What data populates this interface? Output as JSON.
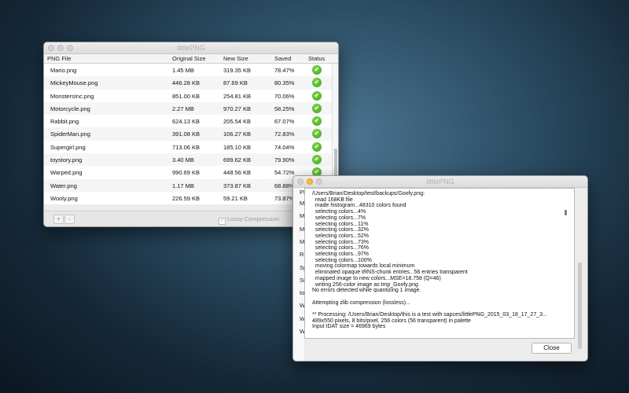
{
  "main_window": {
    "title": "littlePNG",
    "columns": [
      "PNG File",
      "Original Size",
      "New Size",
      "Saved",
      "Status"
    ],
    "rows": [
      {
        "file": "Mario.png",
        "original": "1.45 MB",
        "new": "319.35 KB",
        "saved": "78.47%"
      },
      {
        "file": "MickeyMouse.png",
        "original": "446.28 KB",
        "new": "87.69 KB",
        "saved": "80.35%"
      },
      {
        "file": "MonstersInc.png",
        "original": "851.00 KB",
        "new": "254.81 KB",
        "saved": "70.06%"
      },
      {
        "file": "Motorcycle.png",
        "original": "2.27 MB",
        "new": "970.27 KB",
        "saved": "58.25%"
      },
      {
        "file": "Rabbit.png",
        "original": "624.13 KB",
        "new": "205.54 KB",
        "saved": "67.07%"
      },
      {
        "file": "SpiderMan.png",
        "original": "391.08 KB",
        "new": "106.27 KB",
        "saved": "72.83%"
      },
      {
        "file": "Supergirl.png",
        "original": "713.06 KB",
        "new": "185.10 KB",
        "saved": "74.04%"
      },
      {
        "file": "toystory.png",
        "original": "3.40 MB",
        "new": "699.62 KB",
        "saved": "79.90%"
      },
      {
        "file": "Warped.png",
        "original": "990.69 KB",
        "new": "448.56 KB",
        "saved": "54.72%"
      },
      {
        "file": "Water.png",
        "original": "1.17 MB",
        "new": "373.87 KB",
        "saved": "68.88%"
      },
      {
        "file": "Wooly.png",
        "original": "226.59 KB",
        "new": "59.21 KB",
        "saved": "73.87%"
      }
    ],
    "add_label": "+",
    "remove_label": "-",
    "lossy_label": "Lossy Compression",
    "lossy_checked": "✓"
  },
  "log_window": {
    "title": "littlePNG",
    "partial_header": "PNG",
    "partial_rows": [
      "M",
      "M",
      "M",
      "M",
      "Ra",
      "Sp",
      "Su",
      "to",
      "W",
      "W",
      "W"
    ],
    "lines": [
      "/Users/Brian/Desktop/test/backups/Goofy.png:",
      "  read 168KB file",
      "  made histogram...48310 colors found",
      "  selecting colors...4%",
      "  selecting colors...7%",
      "  selecting colors...11%",
      "  selecting colors...32%",
      "  selecting colors...52%",
      "  selecting colors...73%",
      "  selecting colors...76%",
      "  selecting colors...97%",
      "  selecting colors...100%",
      "  moving colormap towards local minimum",
      "  eliminated opaque tRNS-chunk entries...56 entries transparent",
      "  mapped image to new colors...MSE=18.758 (Q=46)",
      "  writing 256-color image as tmp_Goofy.png",
      "No errors detected while quantizing 1 image.",
      "",
      "Attempting zlib compression (lossless)...",
      "",
      "** Processing: /Users/Brian/Desktop/this is a test with sapces/littlePNG_2015_03_18_17_27_3...",
      "489x550 pixels, 8 bits/pixel, 256 colors (56 transparent) in palette",
      "Input IDAT size = 46969 bytes"
    ],
    "close_label": "Close"
  },
  "icons": {
    "status": "checkmark-icon"
  },
  "colors": {
    "status_ok": "#4cb326",
    "close": "#fc5f57",
    "minimize": "#fdbc2e"
  }
}
